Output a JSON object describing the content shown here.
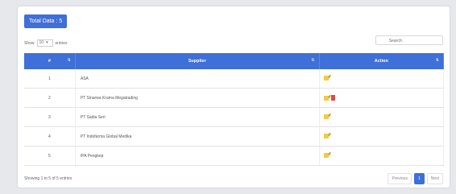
{
  "total_button": "Total Data : 5",
  "length_control": {
    "prefix": "Show",
    "value": "10",
    "suffix": "entries"
  },
  "search": {
    "label": "Search:",
    "value": ""
  },
  "table": {
    "headers": [
      "#",
      "Supplier",
      "Action"
    ],
    "rows": [
      {
        "no": "1",
        "supplier": "ASA"
      },
      {
        "no": "2",
        "supplier": "PT Sinarwa Krama Megatrading"
      },
      {
        "no": "3",
        "supplier": "PT Sadia Seri"
      },
      {
        "no": "4",
        "supplier": "PT Indofarma Global Medika"
      },
      {
        "no": "5",
        "supplier": "IPA Pengkep"
      }
    ]
  },
  "footer": {
    "info": "Showing 1 to 5 of 5 entries"
  },
  "pagination": {
    "previous": "Previous",
    "current": "1",
    "next": "Next"
  },
  "colors": {
    "primary": "#3f6fd8",
    "edit": "#f2c94c",
    "delete": "#e04a4a"
  },
  "icons": {
    "edit": "edit-icon",
    "delete": "delete-icon"
  }
}
